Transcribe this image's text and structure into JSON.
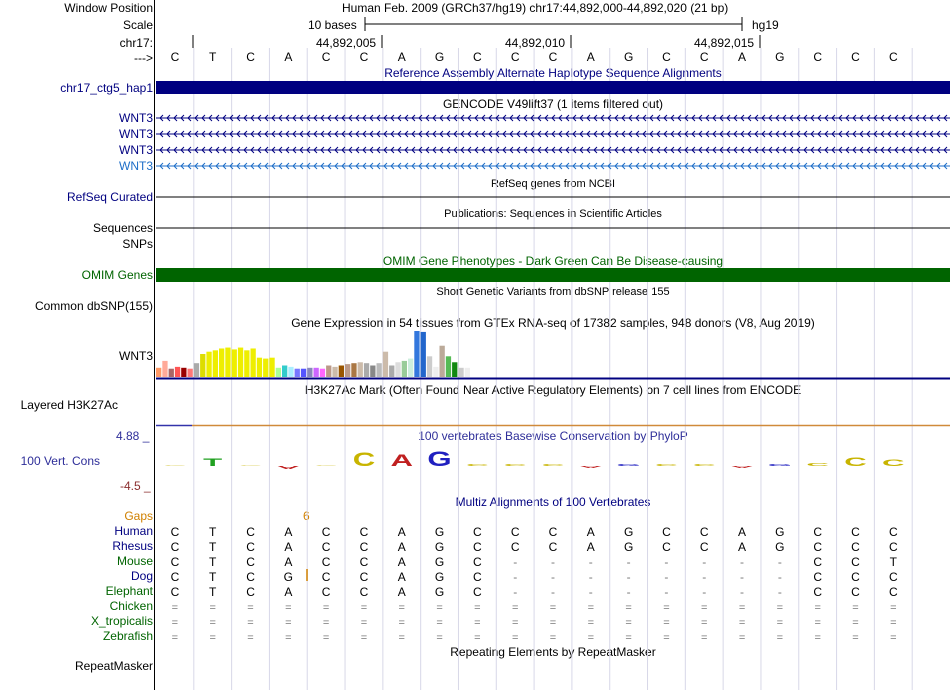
{
  "colors": {
    "navy": "#000080",
    "dark_green": "#006400",
    "ucsc_blue": "#2E2E99",
    "wnt3_light": "#1E6EC8",
    "gaps_orange": "#D08000",
    "cons_low": "#8B2E2E",
    "cons_high": "#5555AA",
    "phylop_c": "#C8B400",
    "phylop_g": "#2020C0",
    "phylop_a": "#C02020",
    "phylop_t": "#20A020"
  },
  "header": {
    "window_position_label": "Window Position",
    "window_position_value": "Human Feb. 2009 (GRCh37/hg19)   chr17:44,892,000-44,892,020 (21 bp)",
    "scale_label": "Scale",
    "scale_value": "10 bases",
    "assembly": "hg19",
    "chrom_label": "chr17:",
    "arrow_label": "--->",
    "coord_ticks": [
      "44,892,005",
      "44,892,010",
      "44,892,015"
    ],
    "bases": [
      "C",
      "T",
      "C",
      "A",
      "C",
      "C",
      "A",
      "G",
      "C",
      "C",
      "C",
      "A",
      "G",
      "C",
      "C",
      "A",
      "G",
      "C",
      "C",
      "C"
    ]
  },
  "tracks": {
    "alt_haplo_title": "Reference Assembly Alternate Haplotype Sequence Alignments",
    "alt_haplo_label": "chr17_ctg5_hap1",
    "gencode_title": "GENCODE V49lift37 (1 items filtered out)",
    "gencode_items": [
      "WNT3",
      "WNT3",
      "WNT3",
      "WNT3"
    ],
    "refseq_title": "RefSeq genes from NCBI",
    "refseq_label": "RefSeq Curated",
    "pubs_title": "Publications: Sequences in Scientific Articles",
    "pubs_label": "Sequences",
    "snps_label": "SNPs",
    "omim_title": "OMIM Gene Phenotypes - Dark Green Can Be Disease-causing",
    "omim_label": "OMIM Genes",
    "dbsnp_title": "Short Genetic Variants from dbSNP release 155",
    "dbsnp_label": "Common dbSNP(155)",
    "gtex_title": "Gene Expression in 54 tissues from GTEx RNA-seq of 17382 samples, 948 donors (V8, Aug 2019)",
    "gtex_label": "WNT3",
    "h3k27_title": "H3K27Ac Mark (Often Found Near Active Regulatory Elements) on 7 cell lines from ENCODE",
    "h3k27_label": "Layered H3K27Ac",
    "phylop_title": "100 vertebrates Basewise Conservation by PhyloP",
    "phylop_label": "100 Vert. Cons",
    "phylop_max": "4.88 _",
    "phylop_min": "-4.5 _",
    "multiz_title": "Multiz Alignments of 100 Vertebrates",
    "gaps_label": "Gaps",
    "gaps_value": "6",
    "repeat_title": "Repeating Elements by RepeatMasker",
    "repeat_label": "RepeatMasker"
  },
  "gtex_bars": [
    {
      "v": 0.2,
      "c": "#FF9966"
    },
    {
      "v": 0.35,
      "c": "#FFAA99"
    },
    {
      "v": 0.18,
      "c": "#AA6666"
    },
    {
      "v": 0.22,
      "c": "#FF5555"
    },
    {
      "v": 0.2,
      "c": "#990000"
    },
    {
      "v": 0.18,
      "c": "#FF7777"
    },
    {
      "v": 0.3,
      "c": "#AAAAAA"
    },
    {
      "v": 0.5,
      "c": "#DDDD00"
    },
    {
      "v": 0.55,
      "c": "#EEEE00"
    },
    {
      "v": 0.58,
      "c": "#EEEE00"
    },
    {
      "v": 0.62,
      "c": "#EEEE00"
    },
    {
      "v": 0.64,
      "c": "#EEEE00"
    },
    {
      "v": 0.6,
      "c": "#EEEE00"
    },
    {
      "v": 0.64,
      "c": "#EEEE00"
    },
    {
      "v": 0.58,
      "c": "#EEEE00"
    },
    {
      "v": 0.62,
      "c": "#EEEE00"
    },
    {
      "v": 0.42,
      "c": "#EEEE00"
    },
    {
      "v": 0.4,
      "c": "#EEEE00"
    },
    {
      "v": 0.42,
      "c": "#EEEE00"
    },
    {
      "v": 0.2,
      "c": "#AAFF99"
    },
    {
      "v": 0.25,
      "c": "#33CCCC"
    },
    {
      "v": 0.22,
      "c": "#AAEEFF"
    },
    {
      "v": 0.18,
      "c": "#7777FF"
    },
    {
      "v": 0.18,
      "c": "#5555FF"
    },
    {
      "v": 0.2,
      "c": "#8888BB"
    },
    {
      "v": 0.2,
      "c": "#CC66FF"
    },
    {
      "v": 0.18,
      "c": "#FF66FF"
    },
    {
      "v": 0.25,
      "c": "#BB9988"
    },
    {
      "v": 0.22,
      "c": "#CCBBAA"
    },
    {
      "v": 0.25,
      "c": "#995500"
    },
    {
      "v": 0.28,
      "c": "#BB9988"
    },
    {
      "v": 0.3,
      "c": "#AA7744"
    },
    {
      "v": 0.32,
      "c": "#CCBBAA"
    },
    {
      "v": 0.3,
      "c": "#AAAAAA"
    },
    {
      "v": 0.25,
      "c": "#888888"
    },
    {
      "v": 0.3,
      "c": "#BBBBBB"
    },
    {
      "v": 0.55,
      "c": "#CCBBAA"
    },
    {
      "v": 0.25,
      "c": "#AAAAAA"
    },
    {
      "v": 0.32,
      "c": "#DDDDDD"
    },
    {
      "v": 0.35,
      "c": "#99CC99"
    },
    {
      "v": 0.4,
      "c": "#CCEEDD"
    },
    {
      "v": 1.0,
      "c": "#3377DD"
    },
    {
      "v": 0.98,
      "c": "#2266CC"
    },
    {
      "v": 0.45,
      "c": "#CCCCCC"
    },
    {
      "v": 0.22,
      "c": "#EEEEEE"
    },
    {
      "v": 0.68,
      "c": "#BBAA99"
    },
    {
      "v": 0.45,
      "c": "#55BB55"
    },
    {
      "v": 0.32,
      "c": "#118811"
    },
    {
      "v": 0.2,
      "c": "#CCCCCC"
    },
    {
      "v": 0.2,
      "c": "#EEEEEE"
    }
  ],
  "phylop_values": [
    0.1,
    0.9,
    0.1,
    -0.35,
    0.1,
    1.6,
    1.4,
    1.75,
    0.2,
    0.2,
    0.2,
    -0.25,
    0.2,
    0.2,
    0.2,
    -0.25,
    0.2,
    0.4,
    1.0,
    0.8
  ],
  "multiz": {
    "species": [
      {
        "name": "Human",
        "color": "#000080",
        "row": "CTCACCAGCCCAGCCAGCCC"
      },
      {
        "name": "Rhesus",
        "color": "#000080",
        "row": "CTCACCAGCCCAGCCAGCCC"
      },
      {
        "name": "Mouse",
        "color": "#006400",
        "row": "CTCACCAGC--------CCT"
      },
      {
        "name": "Dog",
        "color": "#000080",
        "row": "CTCGCCAGC--------CCC"
      },
      {
        "name": "Elephant",
        "color": "#006400",
        "row": "CTCACCAGC--------CCC"
      },
      {
        "name": "Chicken",
        "color": "#006400",
        "row": "===================="
      },
      {
        "name": "X_tropicalis",
        "color": "#006400",
        "row": "===================="
      },
      {
        "name": "Zebrafish",
        "color": "#006400",
        "row": "===================="
      }
    ]
  }
}
